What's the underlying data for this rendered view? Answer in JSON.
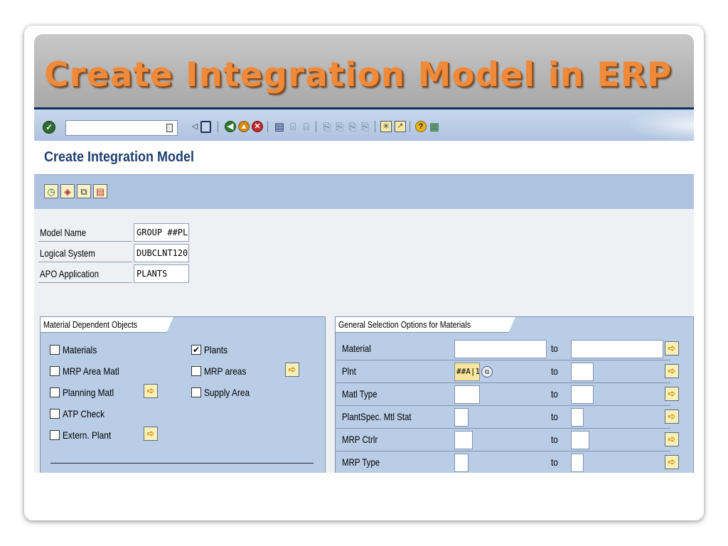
{
  "slide": {
    "title": "Create Integration Model in ERP"
  },
  "toolbar": {
    "command_value": "",
    "icons": [
      "enter-icon",
      "back-nav-icon",
      "save-icon",
      "back-icon",
      "exit-icon",
      "cancel-icon",
      "print-icon",
      "find-icon",
      "find-next-icon",
      "first-page-icon",
      "prev-page-icon",
      "next-page-icon",
      "last-page-icon",
      "create-session-icon",
      "shortcut-icon",
      "help-icon",
      "layout-icon"
    ]
  },
  "screen": {
    "title": "Create Integration Model"
  },
  "app_toolbar": {
    "icons": [
      "execute-icon",
      "variant-icon",
      "get-variant-icon",
      "delete-icon"
    ]
  },
  "header_fields": [
    {
      "label": "Model Name",
      "value": "GROUP ##PL"
    },
    {
      "label": "Logical System",
      "value": "DUBCLNT120"
    },
    {
      "label": "APO Application",
      "value": "PLANTS"
    }
  ],
  "material_objects": {
    "title": "Material Dependent Objects",
    "left_items": [
      {
        "label": "Materials",
        "checked": false
      },
      {
        "label": "MRP Area Matl",
        "checked": false
      },
      {
        "label": "Planning Matl",
        "checked": false
      },
      {
        "label": "ATP Check",
        "checked": false
      },
      {
        "label": "Extern. Plant",
        "checked": false
      }
    ],
    "right_items": [
      {
        "label": "Plants",
        "checked": true
      },
      {
        "label": "MRP areas",
        "checked": false
      },
      {
        "label": "Supply Area",
        "checked": false
      }
    ],
    "check_mark": "✔"
  },
  "selection_options": {
    "title": "General Selection Options for Materials",
    "to_label": "to",
    "rows": [
      {
        "label": "Material",
        "from": "",
        "to": ""
      },
      {
        "label": "Plnt",
        "from": "##A|1",
        "to": ""
      },
      {
        "label": "Matl Type",
        "from": "",
        "to": ""
      },
      {
        "label": "PlantSpec. Mtl Stat",
        "from": "",
        "to": ""
      },
      {
        "label": "MRP Ctrlr",
        "from": "",
        "to": ""
      },
      {
        "label": "MRP Type",
        "from": "",
        "to": ""
      }
    ]
  },
  "colors": {
    "title_orange": "#ef8a3a",
    "sap_blue": "#aec3e0",
    "group_blue": "#b9cde6",
    "screen_title_navy": "#1e3f6e"
  }
}
